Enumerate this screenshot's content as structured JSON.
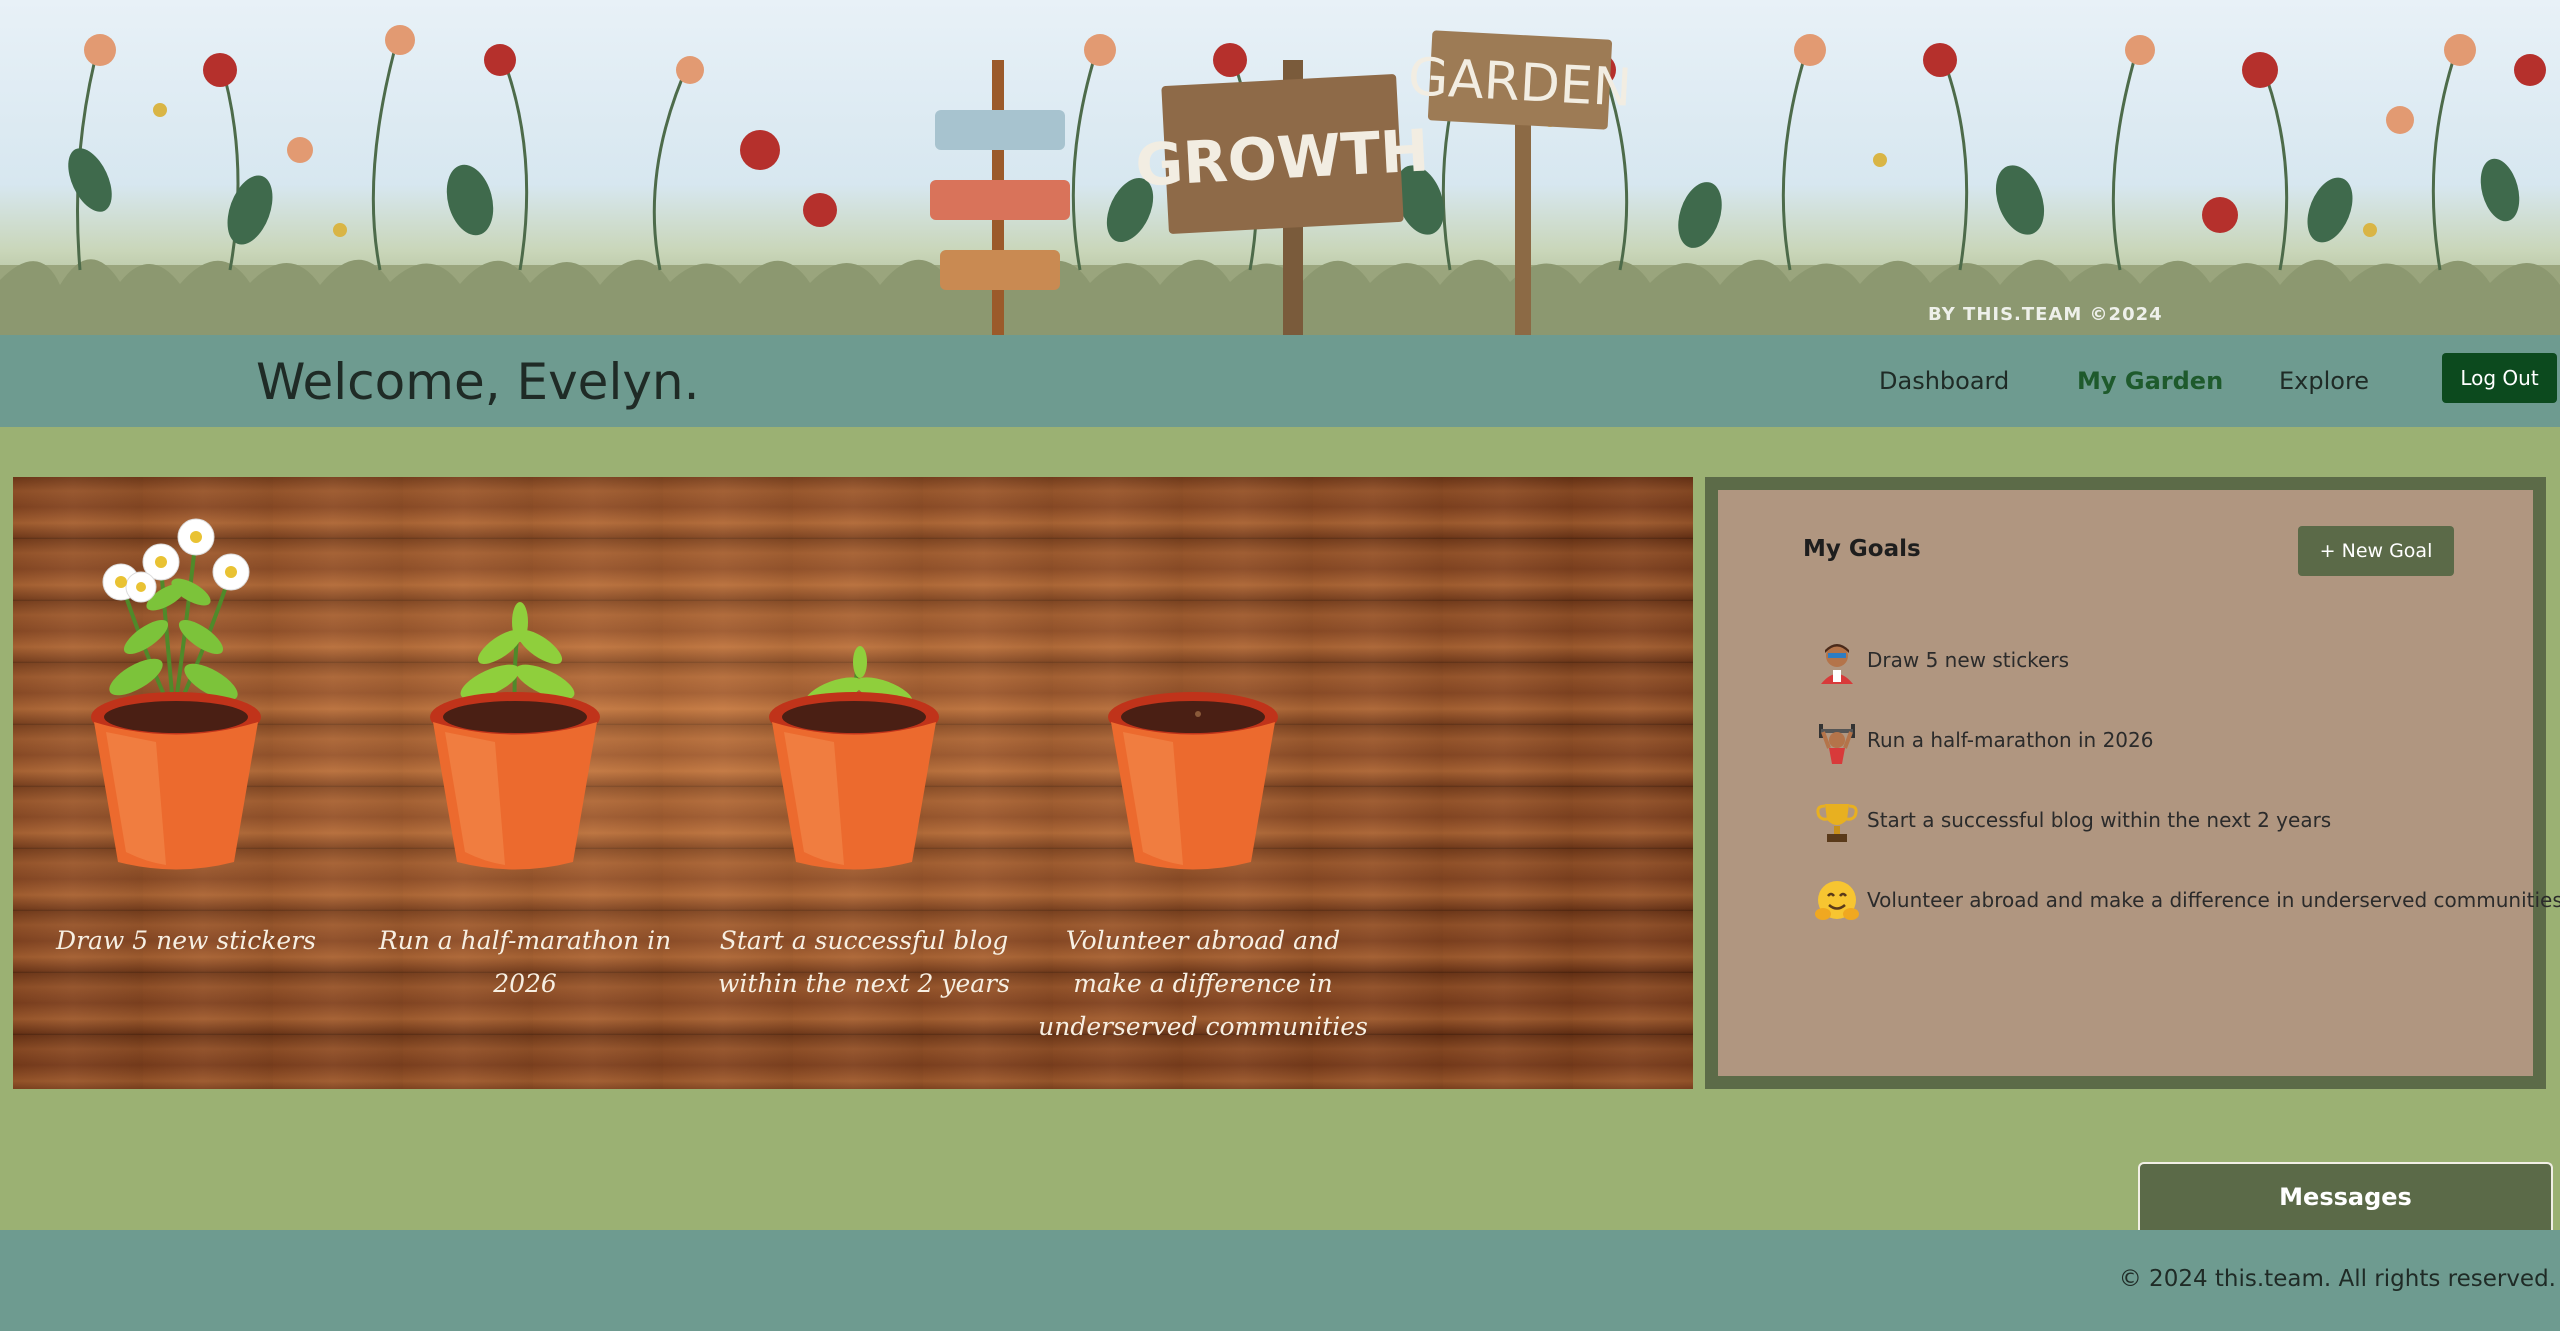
{
  "banner": {
    "sign_left": "GROWTH",
    "sign_right": "GARDEN",
    "art_credit": "BY THIS.TEAM ©2024"
  },
  "header": {
    "welcome": "Welcome, Evelyn.",
    "nav": [
      {
        "label": "Dashboard",
        "active": false
      },
      {
        "label": "My Garden",
        "active": true
      },
      {
        "label": "Explore",
        "active": false
      }
    ],
    "logout_label": "Log Out"
  },
  "garden": {
    "pots": [
      {
        "label": "Draw 5 new stickers",
        "stage": "flowering"
      },
      {
        "label": "Run a half-marathon in 2026",
        "stage": "young plant"
      },
      {
        "label": "Start a successful blog within the next 2 years",
        "stage": "sprout"
      },
      {
        "label": "Volunteer abroad and make a difference in underserved communities",
        "stage": "seed"
      }
    ]
  },
  "goals": {
    "title": "My Goals",
    "new_goal_label": "+ New Goal",
    "items": [
      {
        "icon": "artist-icon",
        "text": "Draw 5 new stickers"
      },
      {
        "icon": "weightlifter-icon",
        "text": "Run a half-marathon in 2026"
      },
      {
        "icon": "trophy-icon",
        "text": "Start a successful blog within the next 2 years"
      },
      {
        "icon": "hugging-face-icon",
        "text": "Volunteer abroad and make a difference in underserved communities"
      }
    ]
  },
  "messages": {
    "label": "Messages"
  },
  "footer": {
    "text": "© 2024 this.team. All rights reserved."
  },
  "colors": {
    "header_bg": "#6e9b90",
    "page_bg": "#9bb173",
    "logout_bg": "#0c4a1e",
    "active_nav": "#1e5a2c",
    "goals_panel_bg": "#b09680",
    "goals_border": "#5c6b48",
    "accent_button": "#5b6a48"
  }
}
